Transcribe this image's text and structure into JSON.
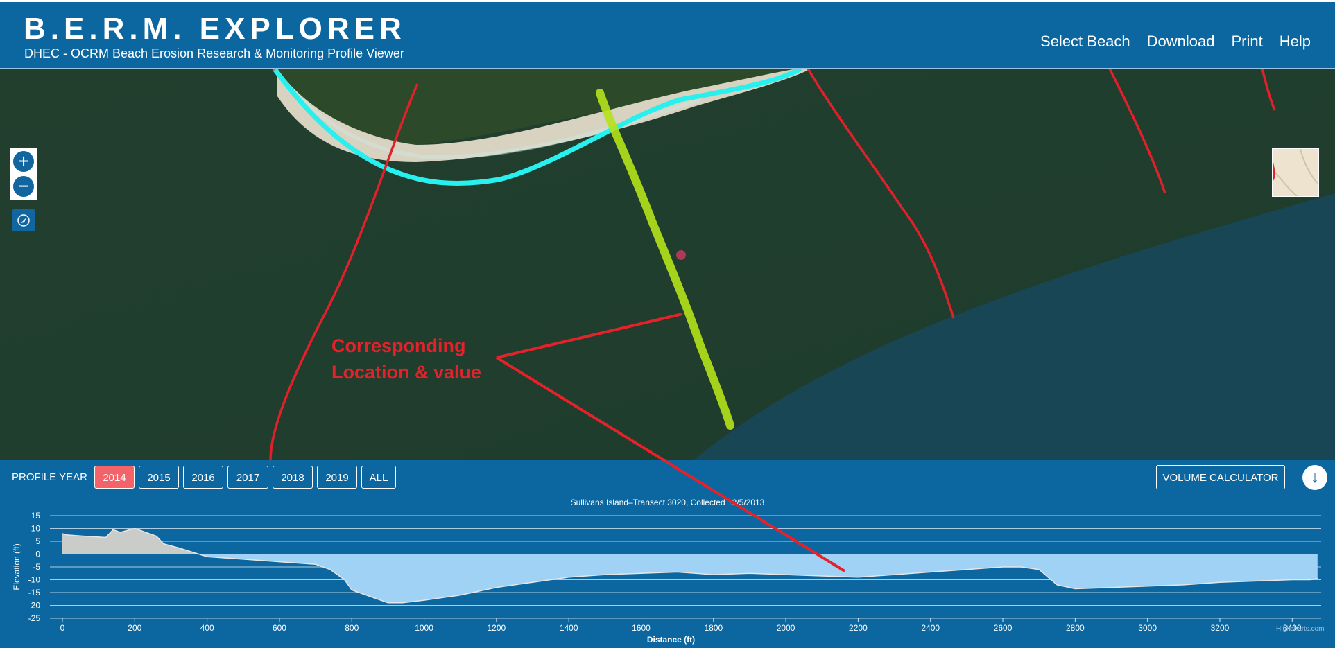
{
  "header": {
    "title": "B.E.R.M. EXPLORER",
    "subtitle": "DHEC - OCRM Beach Erosion Research & Monitoring Profile Viewer",
    "nav": [
      "Select Beach",
      "Download",
      "Print",
      "Help"
    ]
  },
  "map": {
    "zoom_in": "+",
    "zoom_out": "−",
    "annotation_line1": "Corresponding",
    "annotation_line2": "Location & value"
  },
  "panel": {
    "profile_year_label": "PROFILE YEAR",
    "years": [
      "2014",
      "2015",
      "2016",
      "2017",
      "2018",
      "2019",
      "ALL"
    ],
    "active_year": "2014",
    "volume_button": "VOLUME CALCULATOR",
    "collapse_icon": "↓",
    "credit": "Highcharts.com"
  },
  "chart_data": {
    "type": "area",
    "title": "Sullivans Island–Transect 3020, Collected 12/5/2013",
    "xlabel": "Distance (ft)",
    "ylabel": "Elevation (ft)",
    "xlim": [
      0,
      3480
    ],
    "ylim": [
      -25,
      15
    ],
    "x_ticks": [
      0,
      200,
      400,
      600,
      800,
      1000,
      1200,
      1400,
      1600,
      1800,
      2000,
      2200,
      2400,
      2600,
      2800,
      3000,
      3200,
      3400
    ],
    "y_ticks": [
      15,
      10,
      5,
      0,
      -5,
      -10,
      -15,
      -20,
      -25
    ],
    "grid": true,
    "colors": {
      "above_zero": "#c9ccc9",
      "below_zero": "#9fd2f5",
      "line": "#e6e6e6"
    },
    "x": [
      0,
      10,
      60,
      120,
      140,
      160,
      200,
      220,
      260,
      280,
      320,
      400,
      500,
      600,
      700,
      740,
      780,
      800,
      820,
      860,
      900,
      940,
      1000,
      1100,
      1200,
      1300,
      1400,
      1500,
      1600,
      1700,
      1800,
      1900,
      2000,
      2100,
      2200,
      2300,
      2400,
      2500,
      2600,
      2650,
      2700,
      2750,
      2800,
      2900,
      3000,
      3100,
      3200,
      3300,
      3400,
      3450,
      3470
    ],
    "values": [
      8,
      7.5,
      7,
      6.5,
      9.5,
      8.5,
      10,
      9,
      7,
      4,
      2.5,
      -1,
      -2,
      -3,
      -4,
      -6,
      -10,
      -14,
      -15,
      -17,
      -19,
      -19,
      -18,
      -16,
      -13,
      -11,
      -9,
      -8,
      -7.5,
      -7,
      -8,
      -7.5,
      -8,
      -8.5,
      -9,
      -8,
      -7,
      -6,
      -5,
      -5,
      -6,
      -12,
      -13.5,
      -13,
      -12.5,
      -12,
      -11,
      -10.5,
      -10,
      -10,
      -9.5
    ]
  }
}
